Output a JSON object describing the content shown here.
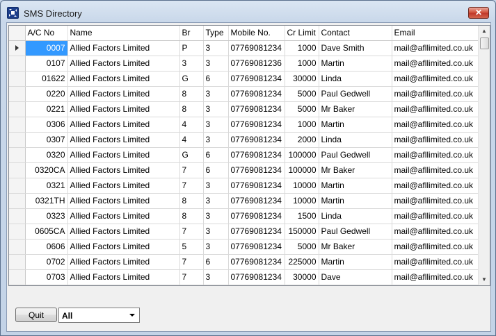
{
  "window": {
    "title": "SMS Directory",
    "close_glyph": "✕"
  },
  "grid": {
    "columns": [
      "A/C No",
      "Name",
      "Br",
      "Type",
      "Mobile No.",
      "Cr Limit",
      "Contact",
      "Email"
    ],
    "current_row": 0,
    "rows": [
      [
        "0007",
        "Allied Factors Limited",
        "P",
        "3",
        "07769081234",
        "1000",
        "Dave Smith",
        "mail@afllimited.co.uk"
      ],
      [
        "0107",
        "Allied Factors Limited",
        "3",
        "3",
        "07769081236",
        "1000",
        "Martin",
        "mail@afllimited.co.uk"
      ],
      [
        "01622",
        "Allied Factors Limited",
        "G",
        "6",
        "07769081234",
        "30000",
        "Linda",
        "mail@afllimited.co.uk"
      ],
      [
        "0220",
        "Allied Factors Limited",
        "8",
        "3",
        "07769081234",
        "5000",
        "Paul Gedwell",
        "mail@afllimited.co.uk"
      ],
      [
        "0221",
        "Allied Factors Limited",
        "8",
        "3",
        "07769081234",
        "5000",
        "Mr Baker",
        "mail@afllimited.co.uk"
      ],
      [
        "0306",
        "Allied Factors Limited",
        "4",
        "3",
        "07769081234",
        "1000",
        "Martin",
        "mail@afllimited.co.uk"
      ],
      [
        "0307",
        "Allied Factors Limited",
        "4",
        "3",
        "07769081234",
        "2000",
        "Linda",
        "mail@afllimited.co.uk"
      ],
      [
        "0320",
        "Allied Factors Limited",
        "G",
        "6",
        "07769081234",
        "100000",
        "Paul Gedwell",
        "mail@afllimited.co.uk"
      ],
      [
        "0320CA",
        "Allied Factors Limited",
        "7",
        "6",
        "07769081234",
        "100000",
        "Mr Baker",
        "mail@afllimited.co.uk"
      ],
      [
        "0321",
        "Allied Factors Limited",
        "7",
        "3",
        "07769081234",
        "10000",
        "Martin",
        "mail@afllimited.co.uk"
      ],
      [
        "0321TH",
        "Allied Factors Limited",
        "8",
        "3",
        "07769081234",
        "10000",
        "Martin",
        "mail@afllimited.co.uk"
      ],
      [
        "0323",
        "Allied Factors Limited",
        "8",
        "3",
        "07769081234",
        "1500",
        "Linda",
        "mail@afllimited.co.uk"
      ],
      [
        "0605CA",
        "Allied Factors Limited",
        "7",
        "3",
        "07769081234",
        "150000",
        "Paul Gedwell",
        "mail@afllimited.co.uk"
      ],
      [
        "0606",
        "Allied Factors Limited",
        "5",
        "3",
        "07769081234",
        "5000",
        "Mr Baker",
        "mail@afllimited.co.uk"
      ],
      [
        "0702",
        "Allied Factors Limited",
        "7",
        "6",
        "07769081234",
        "225000",
        "Martin",
        "mail@afllimited.co.uk"
      ],
      [
        "0703",
        "Allied Factors Limited",
        "7",
        "3",
        "07769081234",
        "30000",
        "Dave",
        "mail@afllimited.co.uk"
      ]
    ]
  },
  "scrollbar": {
    "up_glyph": "▲",
    "down_glyph": "▼"
  },
  "footer": {
    "quit_label": "Quit",
    "filter_value": "All"
  },
  "colors": {
    "selection": "#3399ff",
    "close_button": "#c0392b"
  }
}
